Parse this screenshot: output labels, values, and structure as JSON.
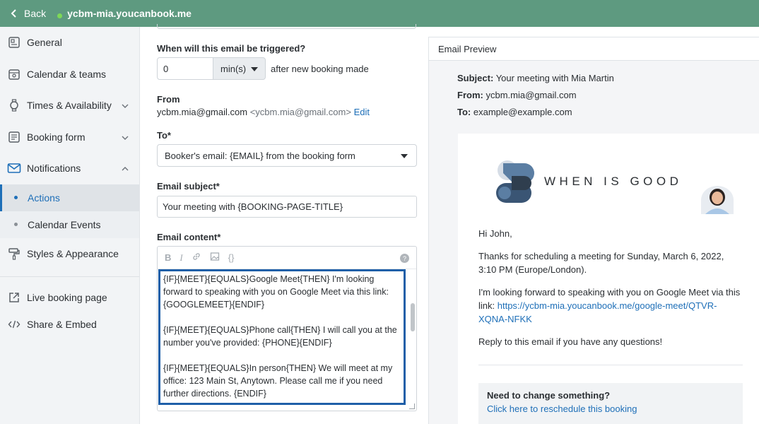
{
  "topbar": {
    "back_label": "Back",
    "site_name": "ycbm-mia.youcanbook.me"
  },
  "sidebar": {
    "items": [
      {
        "label": "General",
        "icon": "document-icon"
      },
      {
        "label": "Calendar & teams",
        "icon": "calendar-people-icon"
      },
      {
        "label": "Times & Availability",
        "icon": "watch-icon"
      },
      {
        "label": "Booking form",
        "icon": "form-icon"
      },
      {
        "label": "Notifications",
        "icon": "mail-icon"
      }
    ],
    "sub_items": [
      {
        "label": "Actions"
      },
      {
        "label": "Calendar Events"
      }
    ],
    "styles_label": "Styles & Appearance",
    "live_label": "Live booking page",
    "share_label": "Share & Embed"
  },
  "form": {
    "trigger_label": "When will this email be triggered?",
    "trigger_value": "0",
    "trigger_unit": "min(s)",
    "trigger_after": "after new booking made",
    "from_label": "From",
    "from_email": "ycbm.mia@gmail.com",
    "from_sender": "<ycbm.mia@gmail.com>",
    "from_edit": "Edit",
    "to_label": "To*",
    "to_value": "Booker's email: {EMAIL} from the booking form",
    "subject_label": "Email subject*",
    "subject_value": "Your meeting with {BOOKING-PAGE-TITLE}",
    "content_label": "Email content*",
    "toolbar": {
      "bold": "B",
      "italic": "I",
      "braces": "{}",
      "help": "?"
    },
    "content_paragraphs": [
      "{IF}{MEET}{EQUALS}Google Meet{THEN} I'm looking forward to speaking with you on Google Meet via this link: {GOOGLEMEET}{ENDIF}",
      "{IF}{MEET}{EQUALS}Phone call{THEN} I will call you at the number you've provided: {PHONE}{ENDIF}",
      "{IF}{MEET}{EQUALS}In person{THEN} We will meet at my office: 123 Main St, Anytown. Please call me if you need further directions. {ENDIF}"
    ]
  },
  "preview": {
    "header": "Email Preview",
    "subject_label": "Subject:",
    "subject_value": "Your meeting with Mia Martin",
    "from_label": "From:",
    "from_value": "ycbm.mia@gmail.com",
    "to_label": "To:",
    "to_value": "example@example.com",
    "brand": "WHEN IS GOOD",
    "greeting": "Hi John,",
    "para1": "Thanks for scheduling a meeting for Sunday, March 6, 2022, 3:10 PM (Europe/London).",
    "para2_text": "I'm looking forward to speaking with you on Google Meet via this link:",
    "para2_link": "https://ycbm-mia.youcanbook.me/google-meet/QTVR-XQNA-NFKK",
    "para3": "Reply to this email if you have any questions!",
    "change_heading": "Need to change something?",
    "change_link": "Click here to reschedule this booking"
  },
  "colors": {
    "topbar": "#5e9a80",
    "accent": "#1e6fb8",
    "focus_border": "#1f5fa8",
    "brand_dark": "#2f3e4e",
    "brand_blue": "#5b7ea3"
  }
}
